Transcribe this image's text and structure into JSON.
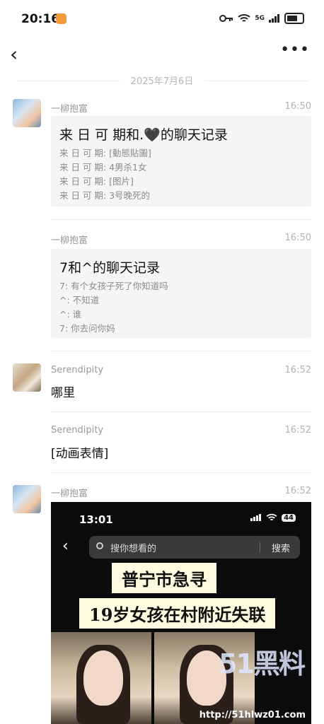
{
  "status_bar": {
    "time": "20:16",
    "network_label": "5G",
    "icons": [
      "key-icon",
      "wifi-icon",
      "signal-icon",
      "battery-icon"
    ]
  },
  "header": {
    "back_icon": "‹",
    "more_icon": "•••"
  },
  "date_divider": "2025年7月6日",
  "messages": [
    {
      "sender": "一柳抱富",
      "time": "16:50",
      "card": {
        "title": "来 日 可 期和.🖤的聊天记录",
        "lines": [
          "来 日 可 期: [動態貼圖]",
          "来 日 可 期: 4男杀1女",
          "来 日 可 期: [图片]",
          "来 日 可 期: 3号晚死的"
        ]
      }
    },
    {
      "sender": "一柳抱富",
      "time": "16:50",
      "card": {
        "title": "7和^的聊天记录",
        "lines": [
          "7: 有个女孩子死了你知道吗",
          "^: 不知道",
          "^: 谁",
          "7: 你去问你妈"
        ]
      }
    },
    {
      "sender": "Serendipity",
      "time": "16:52",
      "text": "哪里"
    },
    {
      "sender": "Serendipity",
      "time": "16:52",
      "text": "[动画表情]"
    },
    {
      "sender": "一柳抱富",
      "time": "16:52",
      "image": {
        "phone_time": "13:01",
        "phone_battery": "44",
        "search_placeholder": "搜你想看的",
        "search_button": "搜索",
        "headline_1": "普宁市急寻",
        "headline_2": "19岁女孩在村附近失联",
        "watermark_logo": "51黑料",
        "watermark_url": "http://51hlwz01.com"
      }
    }
  ],
  "colors": {
    "card_bg": "#f5f5f5",
    "meta_text": "#999999",
    "headline_bg": "#fffbe0"
  }
}
